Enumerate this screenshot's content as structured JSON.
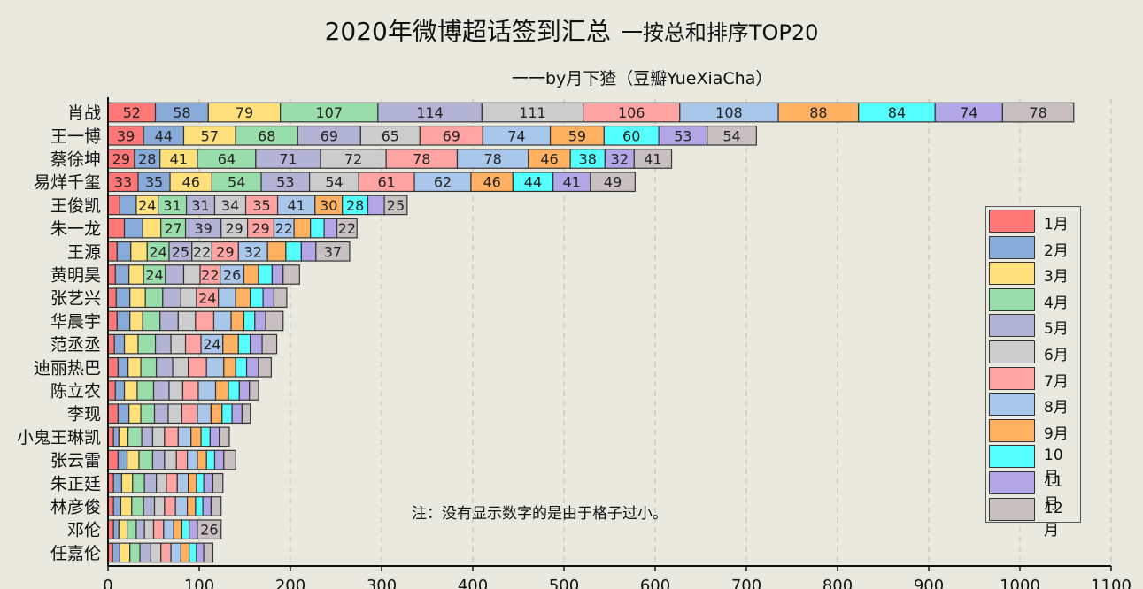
{
  "title": "2020年微博超话签到汇总",
  "title_suffix": "一按总和排序TOP20",
  "subtitle": "一一by月下猹（豆瓣YueXiaCha）",
  "note": "注：没有显示数字的是由于格子过小。",
  "chart_data": {
    "type": "bar",
    "orientation": "horizontal",
    "stacked": true,
    "xlim": [
      0,
      1100
    ],
    "xticks": [
      0,
      100,
      200,
      300,
      400,
      500,
      600,
      700,
      800,
      900,
      1000,
      1100
    ],
    "legend_position": "right",
    "grid": "vertical-dashed",
    "series": [
      {
        "name": "1月",
        "color": "#ff7777"
      },
      {
        "name": "2月",
        "color": "#88aad8"
      },
      {
        "name": "3月",
        "color": "#ffe07a"
      },
      {
        "name": "4月",
        "color": "#99ddaa"
      },
      {
        "name": "5月",
        "color": "#b3b3d6"
      },
      {
        "name": "6月",
        "color": "#cccccc"
      },
      {
        "name": "7月",
        "color": "#ffa3a3"
      },
      {
        "name": "8月",
        "color": "#a9c7ea"
      },
      {
        "name": "9月",
        "color": "#ffb060"
      },
      {
        "name": "10月",
        "color": "#55ffff"
      },
      {
        "name": "11月",
        "color": "#b3a6e6"
      },
      {
        "name": "12月",
        "color": "#c8c0c0"
      }
    ],
    "categories": [
      "肖战",
      "王一博",
      "蔡徐坤",
      "易烊千玺",
      "王俊凯",
      "朱一龙",
      "王源",
      "黄明昊",
      "张艺兴",
      "华晨宇",
      "范丞丞",
      "迪丽热巴",
      "陈立农",
      "李现",
      "小鬼王琳凯",
      "张云雷",
      "朱正廷",
      "林彦俊",
      "邓伦",
      "任嘉伦"
    ],
    "values": [
      [
        52,
        58,
        79,
        107,
        114,
        111,
        106,
        108,
        88,
        84,
        74,
        78
      ],
      [
        39,
        44,
        57,
        68,
        69,
        65,
        69,
        74,
        59,
        60,
        53,
        54
      ],
      [
        29,
        28,
        41,
        64,
        71,
        72,
        78,
        78,
        46,
        38,
        32,
        41
      ],
      [
        33,
        35,
        46,
        54,
        53,
        54,
        61,
        62,
        46,
        44,
        41,
        49
      ],
      [
        13,
        18,
        24,
        31,
        31,
        34,
        35,
        41,
        30,
        28,
        18,
        25
      ],
      [
        18,
        20,
        20,
        27,
        39,
        29,
        29,
        22,
        18,
        15,
        14,
        22
      ],
      [
        10,
        15,
        18,
        24,
        25,
        22,
        29,
        32,
        20,
        17,
        16,
        37
      ],
      [
        8,
        15,
        16,
        24,
        20,
        18,
        22,
        26,
        16,
        15,
        12,
        18
      ],
      [
        9,
        15,
        17,
        19,
        20,
        17,
        24,
        19,
        16,
        14,
        12,
        14
      ],
      [
        10,
        14,
        14,
        19,
        20,
        19,
        20,
        19,
        14,
        12,
        12,
        19
      ],
      [
        7,
        11,
        15,
        19,
        17,
        16,
        17,
        24,
        17,
        13,
        13,
        16
      ],
      [
        11,
        11,
        14,
        17,
        18,
        17,
        20,
        19,
        13,
        12,
        13,
        14
      ],
      [
        8,
        10,
        14,
        18,
        17,
        15,
        17,
        19,
        14,
        12,
        11,
        10
      ],
      [
        11,
        12,
        13,
        15,
        15,
        15,
        17,
        15,
        12,
        11,
        11,
        9
      ],
      [
        6,
        6,
        10,
        15,
        12,
        13,
        15,
        14,
        11,
        10,
        10,
        11
      ],
      [
        11,
        10,
        13,
        15,
        13,
        13,
        12,
        11,
        10,
        9,
        10,
        13
      ],
      [
        6,
        9,
        12,
        13,
        13,
        11,
        12,
        12,
        9,
        8,
        10,
        11
      ],
      [
        6,
        8,
        12,
        13,
        12,
        11,
        12,
        13,
        9,
        8,
        9,
        11
      ],
      [
        6,
        6,
        9,
        10,
        9,
        10,
        11,
        11,
        9,
        8,
        9,
        26
      ],
      [
        5,
        8,
        11,
        11,
        12,
        11,
        11,
        11,
        9,
        8,
        8,
        10
      ]
    ],
    "label_min": 22
  }
}
